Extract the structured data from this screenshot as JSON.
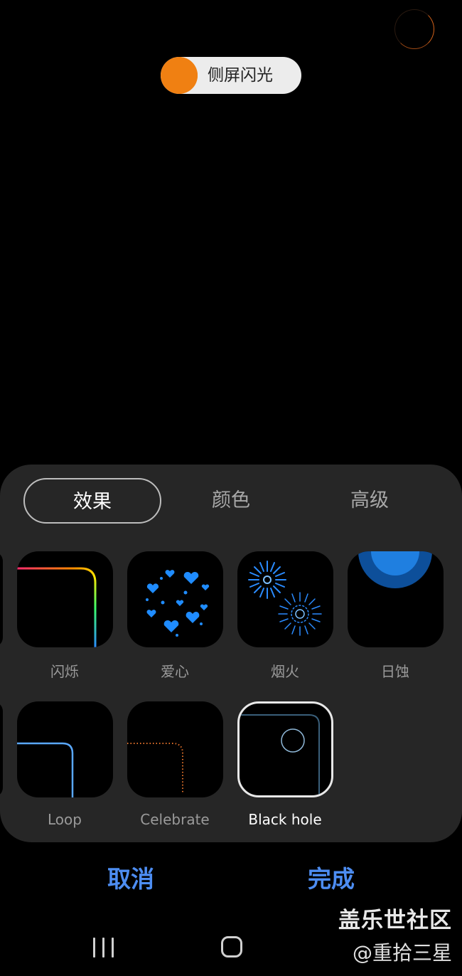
{
  "toggle": {
    "label": "侧屏闪光",
    "state": "on",
    "color": "#f08012"
  },
  "tabs": [
    {
      "label": "效果",
      "active": true
    },
    {
      "label": "颜色",
      "active": false
    },
    {
      "label": "高级",
      "active": false
    }
  ],
  "effects": [
    {
      "label": "闪烁",
      "icon": "rainbow-corner-icon"
    },
    {
      "label": "爱心",
      "icon": "hearts-icon"
    },
    {
      "label": "烟火",
      "icon": "fireworks-icon"
    },
    {
      "label": "日蚀",
      "icon": "eclipse-icon"
    },
    {
      "label": "Loop",
      "icon": "loop-corner-icon"
    },
    {
      "label": "Celebrate",
      "icon": "celebrate-dots-icon"
    },
    {
      "label": "Black hole",
      "icon": "black-hole-icon",
      "selected": true
    }
  ],
  "actions": {
    "cancel": "取消",
    "done": "完成",
    "color": "#4d8df2"
  },
  "watermark": {
    "line1": "盖乐世社区",
    "line2": "@重拾三星"
  }
}
